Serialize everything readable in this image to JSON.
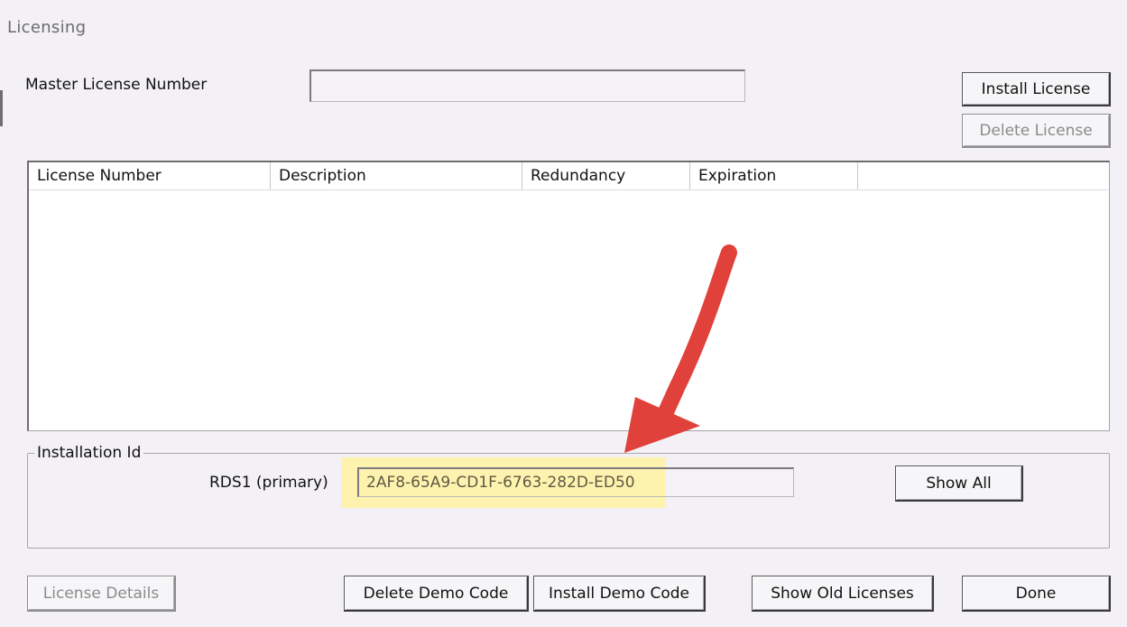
{
  "window": {
    "title": "Licensing"
  },
  "master_license": {
    "label": "Master License Number",
    "value": ""
  },
  "buttons": {
    "install_license": "Install License",
    "delete_license": "Delete License",
    "show_all": "Show All",
    "license_details": "License Details",
    "delete_demo_code": "Delete Demo Code",
    "install_demo_code": "Install Demo Code",
    "show_old_licenses": "Show Old Licenses",
    "done": "Done"
  },
  "license_table": {
    "columns": [
      "License Number",
      "Description",
      "Redundancy",
      "Expiration",
      ""
    ],
    "rows": []
  },
  "installation_id": {
    "group_label": "Installation Id",
    "server_label": "RDS1 (primary)",
    "value": "2AF8-65A9-CD1F-6763-282D-ED50"
  },
  "colors": {
    "annotation_arrow": "#e0413a",
    "highlight": "#fff3a1",
    "window_background": "#f3f1f5"
  }
}
